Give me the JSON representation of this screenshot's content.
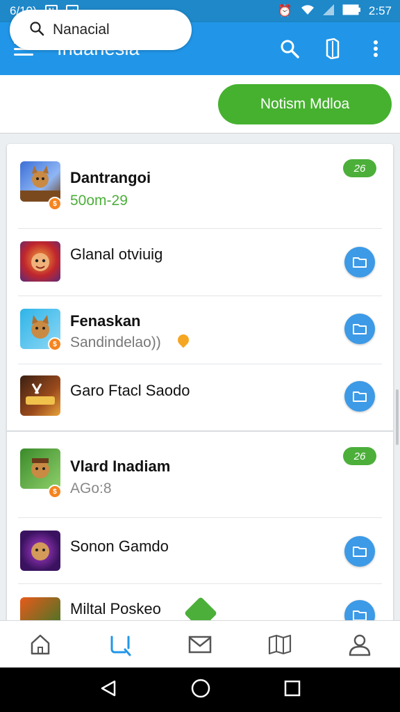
{
  "status_bar": {
    "time_left": "6/10)",
    "time_right": "2:57",
    "icon_n": "N"
  },
  "app_bar": {
    "title": "Indanesia"
  },
  "search": {
    "text": "Nanacial"
  },
  "action_button": {
    "label": "Notism Mdloa"
  },
  "list": [
    {
      "title": "Dantrangoi",
      "subtitle": "50om-29",
      "subtitle_color": "#4caf3a",
      "badge": "26",
      "has_coin": true
    },
    {
      "title": "Glanal otviuig",
      "subtitle": "",
      "badge": "",
      "has_coin": false
    },
    {
      "title": "Fenaskan",
      "subtitle": "Sandindelao))",
      "subtitle_color": "#777777",
      "badge": "",
      "has_coin": true
    },
    {
      "title": "Garo Ftacl Saodo",
      "subtitle": "",
      "badge": "",
      "has_coin": false
    },
    {
      "title": "Vlard Inadiam",
      "subtitle": "AGo:8",
      "subtitle_color": "#888888",
      "badge": "26",
      "has_coin": true
    },
    {
      "title": "Sonon Gamdo",
      "subtitle": "",
      "badge": "",
      "has_coin": false
    },
    {
      "title": "Miltal Poskeo",
      "subtitle": "",
      "badge": "",
      "has_coin": false
    }
  ],
  "bottom_nav": [
    "home-icon",
    "search-icon",
    "mail-icon",
    "map-icon",
    "profile-icon"
  ],
  "colors": {
    "app_bar": "#2196e8",
    "green": "#46b12f",
    "accent_blue": "#3d9ae6"
  }
}
